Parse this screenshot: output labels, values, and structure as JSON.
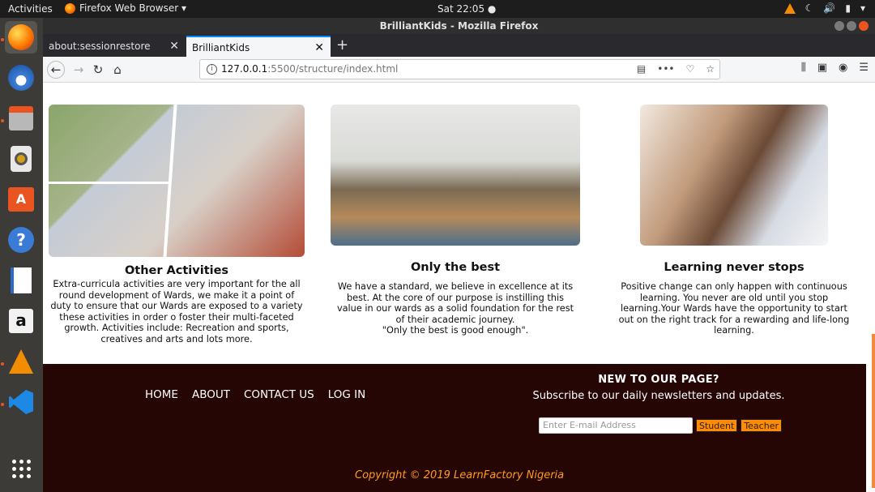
{
  "topbar": {
    "activities": "Activities",
    "app_menu": "Firefox Web Browser ▾",
    "clock": "Sat 22:05 ●"
  },
  "window": {
    "title": "BrilliantKids - Mozilla Firefox"
  },
  "tabs": [
    {
      "label": "about:sessionrestore",
      "active": false
    },
    {
      "label": "BrilliantKids",
      "active": true
    }
  ],
  "urlbar": {
    "host": "127.0.0.1",
    "path": ":5500/structure/index.html"
  },
  "cards": [
    {
      "title": "Other Activities",
      "body": "Extra-curricula activities are very important for the all round development of Wards, we make it a point of duty to ensure that our Wards are exposed to a variety these activities in order o foster their multi-faceted growth. Activities include: Recreation and sports, creatives and arts and lots more."
    },
    {
      "title": "Only the best",
      "body": "We have a standard, we believe in excellence at its best. At the core of our purpose is instilling this value in our wards as a solid foundation for the rest of their academic journey.",
      "quote": "\"Only the best is good enough\"."
    },
    {
      "title": "Learning never stops",
      "body": "Positive change can only happen with continuous learning. You never are old until you stop learning.Your Wards have the opportunity to start out on the right track for a rewarding and life-long learning."
    }
  ],
  "footer": {
    "nav": [
      "HOME",
      "ABOUT",
      "CONTACT US",
      "LOG IN"
    ],
    "newsletter_title": "NEW TO OUR PAGE?",
    "newsletter_text": "Subscribe to our daily newsletters and updates.",
    "email_placeholder": "Enter E-mail Address",
    "student_btn": "Student",
    "teacher_btn": "Teacher",
    "copyright": "Copyright © 2019 LearnFactory Nigeria"
  },
  "colors": {
    "footer_bg": "#260505",
    "accent_orange": "#ff8c00",
    "ubuntu_orange": "#e95420"
  }
}
